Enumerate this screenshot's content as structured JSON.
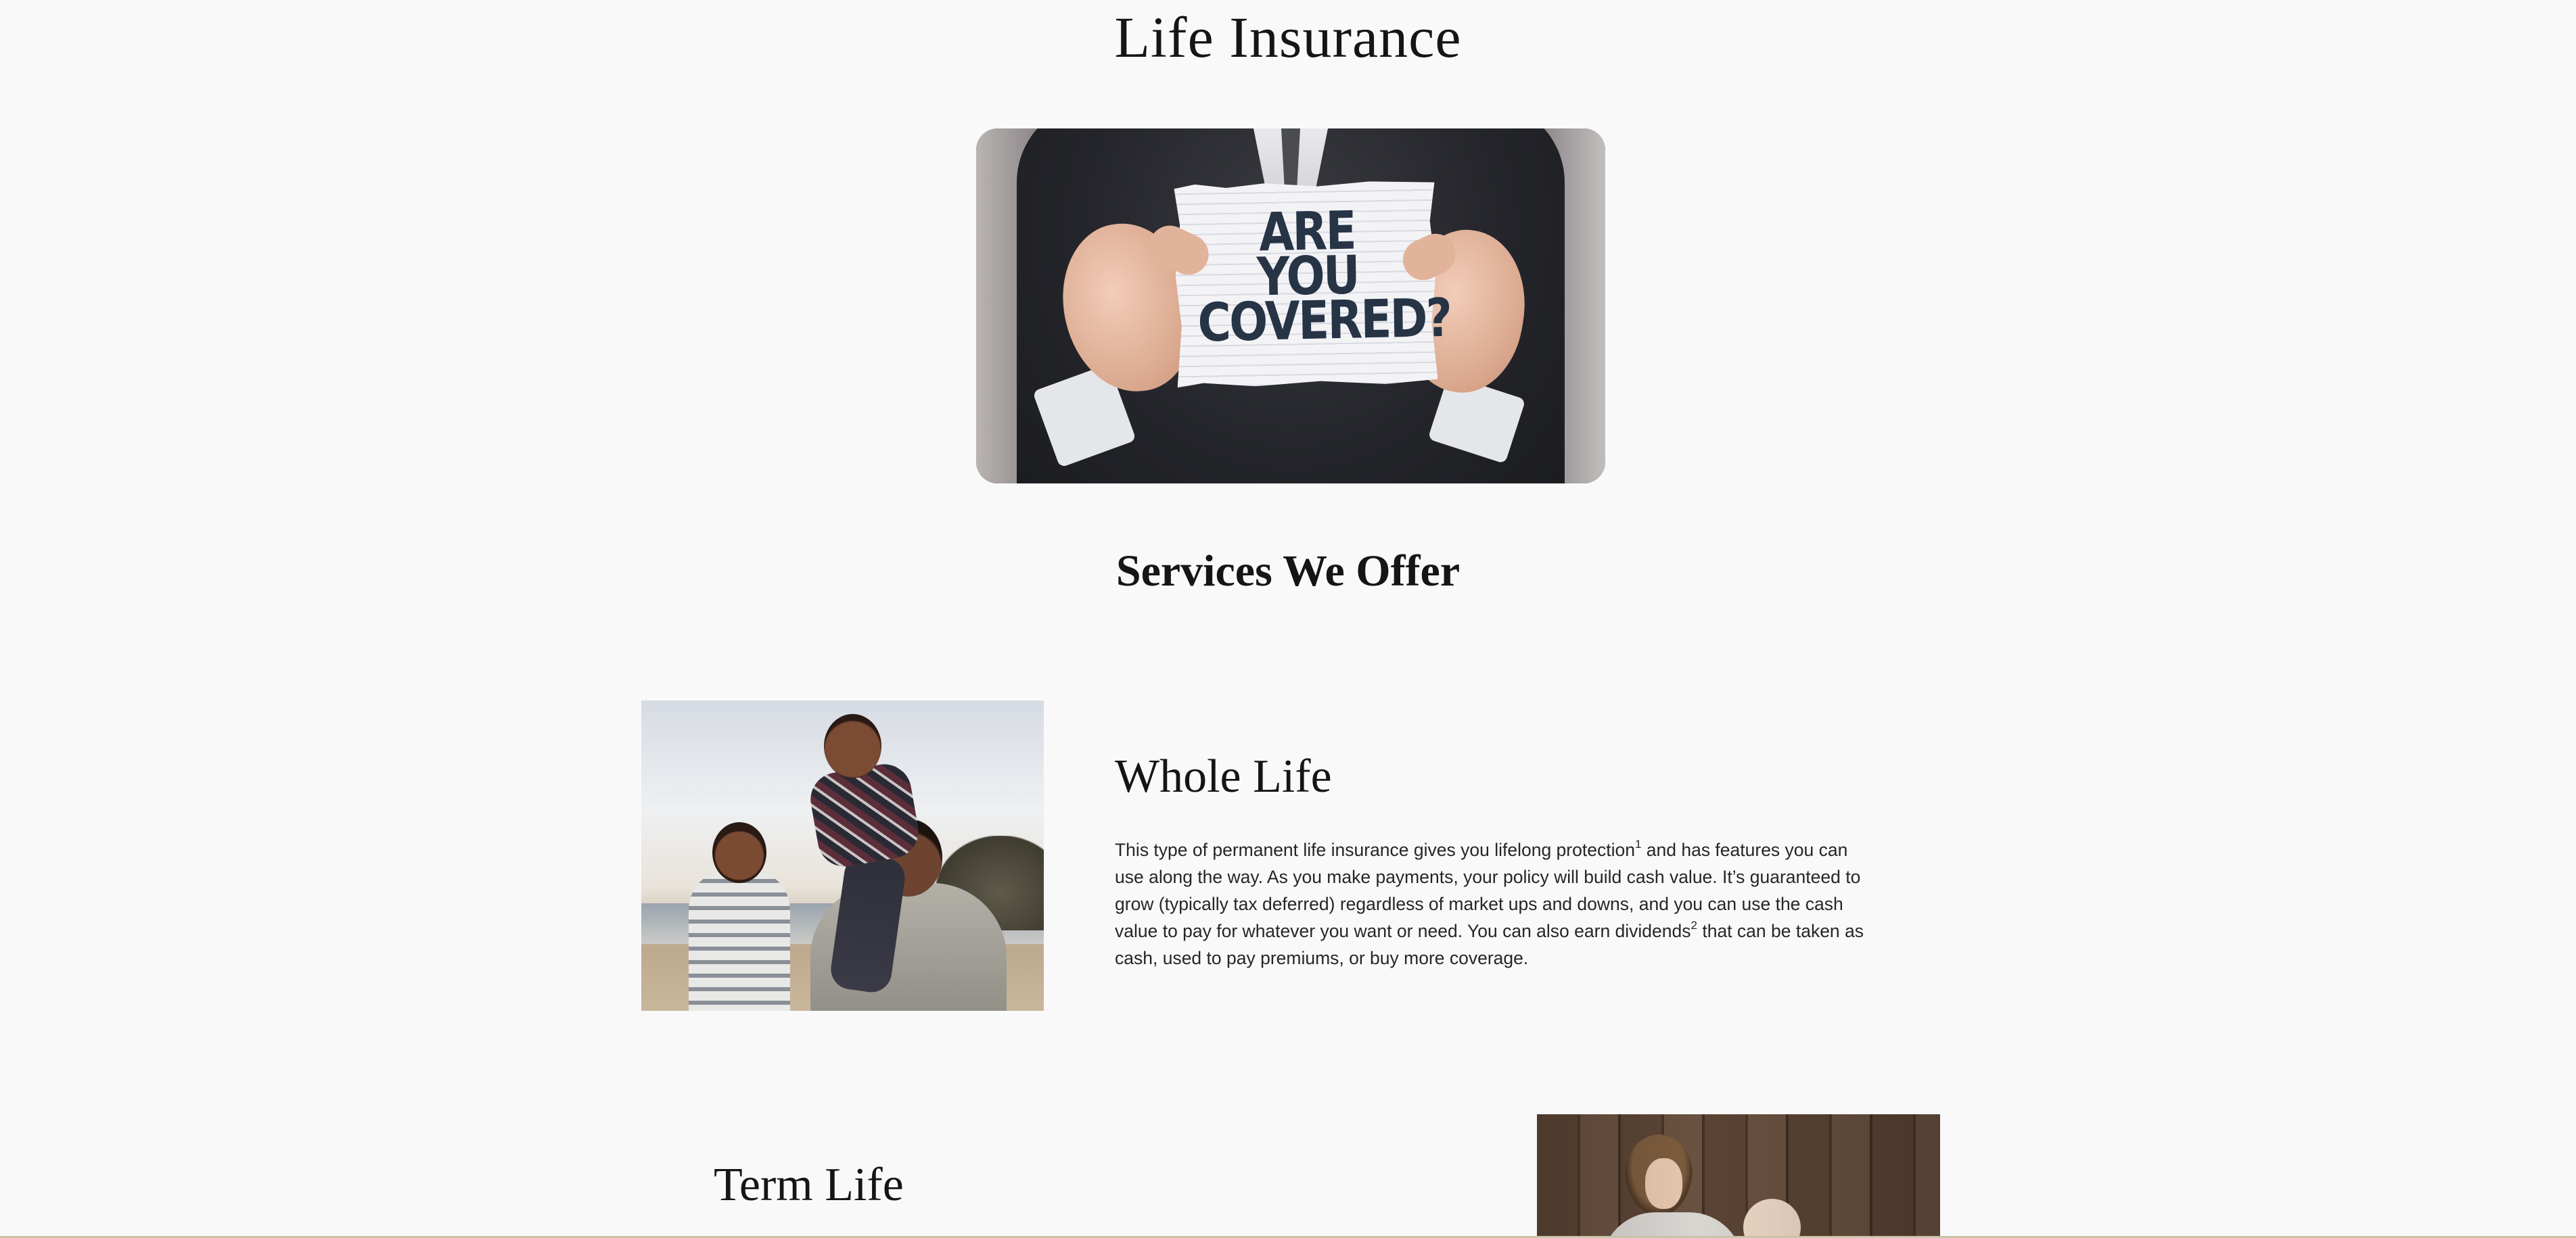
{
  "page": {
    "title": "Life Insurance"
  },
  "hero": {
    "sign_text": "ARE YOU COVERED?",
    "sign_lines": [
      "ARE",
      "YOU",
      "COVERED?"
    ]
  },
  "services": {
    "heading": "Services We Offer",
    "items": [
      {
        "title": "Whole Life",
        "body_parts": [
          "This type of permanent life insurance gives you lifelong protection",
          "1",
          " and has features you can use along the way. As you make payments, your policy will build cash value. It’s guaranteed to grow (typically tax deferred) regardless of market ups and downs, and you can use the cash value to pay for whatever you want or need. You can also earn dividends",
          "2",
          " that can be taken as cash, used to pay premiums, or buy more coverage."
        ],
        "image": "family-on-beach-photo"
      },
      {
        "title": "Term Life",
        "image": "mother-and-child-photo"
      }
    ]
  },
  "colors": {
    "background": "#f9f9f9",
    "text": "#151515",
    "sign_ink": "#263445"
  }
}
